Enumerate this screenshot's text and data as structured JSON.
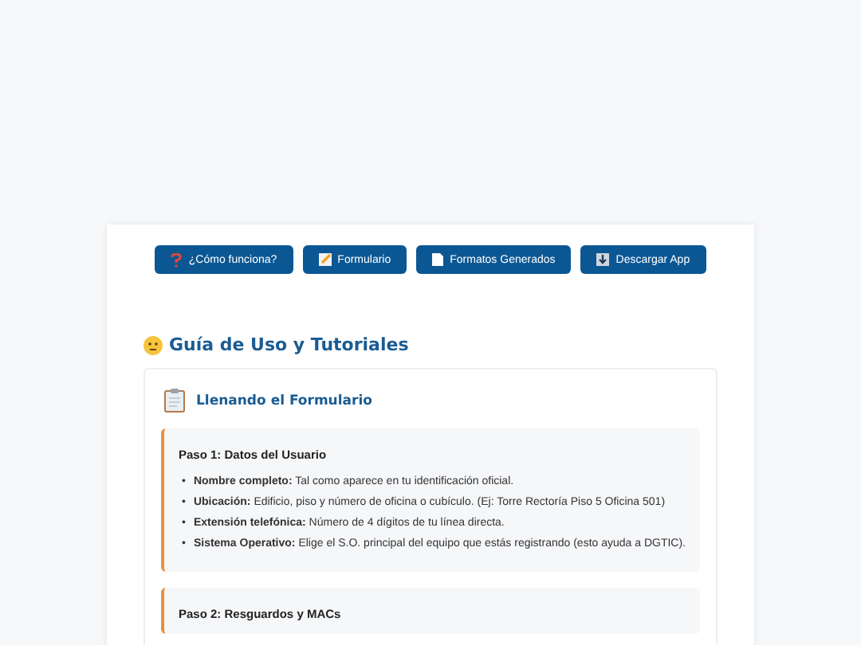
{
  "nav_buttons": [
    {
      "kind": "question",
      "label": "¿Cómo funciona?"
    },
    {
      "kind": "memo",
      "label": "Formulario"
    },
    {
      "kind": "document",
      "label": "Formatos Generados"
    },
    {
      "kind": "download",
      "label": "Descargar App"
    }
  ],
  "guide": {
    "title": "Guía de Uso y Tutoriales",
    "section": {
      "title": "Llenando el Formulario",
      "steps": [
        {
          "title": "Paso 1: Datos del Usuario",
          "items": [
            {
              "marker": "•",
              "text": "**Nombre completo:** Tal como aparece en tu identificación oficial."
            },
            {
              "marker": "•",
              "text": "**Ubicación:** Edificio, piso y número de oficina o cubículo. (Ej: Torre Rectoría Piso 5 Oficina 501)"
            },
            {
              "marker": "•",
              "text": "**Extensión telefónica:** Número de 4 dígitos de tu línea directa."
            },
            {
              "marker": "•",
              "text": "**Sistema Operativo:** Elige el S.O. principal del equipo que estás registrando (esto ayuda a DGTIC)."
            }
          ]
        },
        {
          "title": "Paso 2: Resguardos y MACs"
        }
      ]
    }
  }
}
